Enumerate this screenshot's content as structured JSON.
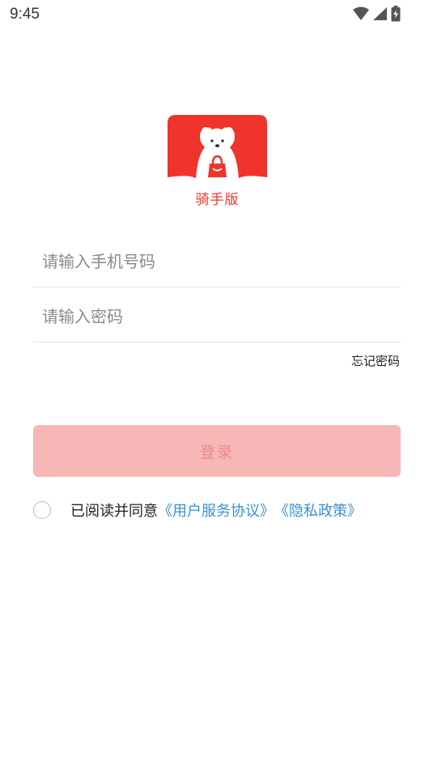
{
  "status_bar": {
    "time": "9:45",
    "icons": [
      "wifi-icon",
      "cellular-signal-icon",
      "battery-charging-icon"
    ]
  },
  "logo": {
    "caption": "骑手版",
    "brand_color": "#f0342b"
  },
  "form": {
    "phone_placeholder": "请输入手机号码",
    "password_placeholder": "请输入密码",
    "forgot_label": "忘记密码",
    "login_label": "登录",
    "login_button_color": "#f8b7b7",
    "login_text_color": "#e88a88"
  },
  "agreement": {
    "checked": false,
    "prefix": "已阅读并同意",
    "service_link": "《用户服务协议》",
    "privacy_link": "《隐私政策》",
    "link_color": "#3a8fd9"
  }
}
